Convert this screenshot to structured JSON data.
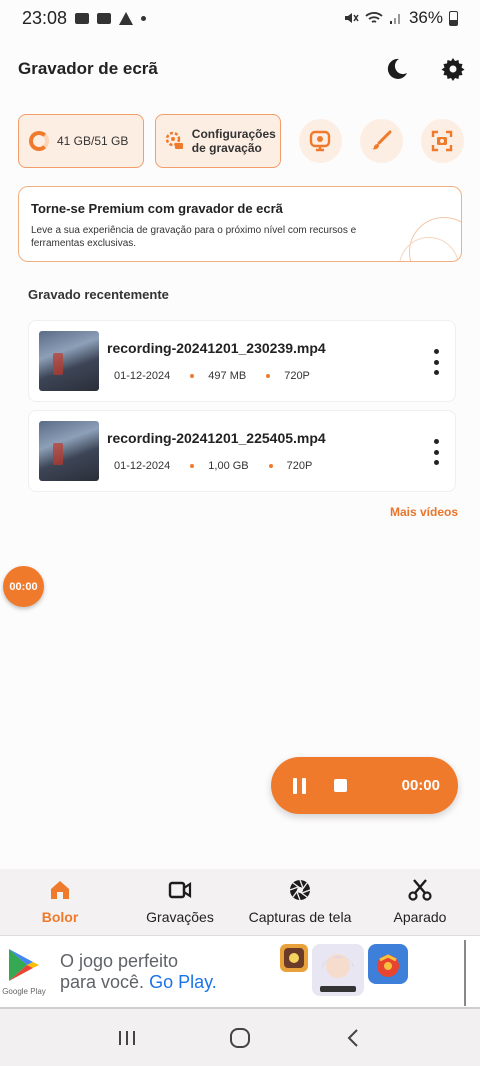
{
  "status_bar": {
    "time": "23:08",
    "battery": "36%"
  },
  "header": {
    "title": "Gravador de ecrã",
    "icons": [
      "moon-icon",
      "gear-icon"
    ]
  },
  "tools": {
    "storage_label": "41 GB/51 GB",
    "config_label_line1": "Configurações",
    "config_label_line2": "de gravação",
    "round_tools": [
      "webcam-icon",
      "brush-icon",
      "screenshot-icon"
    ]
  },
  "premium": {
    "title": "Torne-se Premium com gravador de ecrã",
    "description": "Leve a sua experiência de gravação para o próximo nível com recursos e ferramentas exclusivas."
  },
  "recent": {
    "section_title": "Gravado recentemente",
    "items": [
      {
        "name": "recording-20241201_230239.mp4",
        "date": "01-12-2024",
        "size": "497 MB",
        "resolution": "720P"
      },
      {
        "name": "recording-20241201_225405.mp4",
        "date": "01-12-2024",
        "size": "1,00 GB",
        "resolution": "720P"
      }
    ],
    "more_label": "Mais vídeos"
  },
  "floating_timer": "00:00",
  "record_bar": {
    "time": "00:00"
  },
  "bottom_nav": {
    "items": [
      {
        "label": "Bolor",
        "icon": "home-icon",
        "active": true
      },
      {
        "label": "Gravações",
        "icon": "video-camera-icon",
        "active": false
      },
      {
        "label": "Capturas de tela",
        "icon": "aperture-icon",
        "active": false
      },
      {
        "label": "Aparado",
        "icon": "scissors-icon",
        "active": false
      }
    ]
  },
  "ad": {
    "logo_label": "Google Play",
    "line1": "O jogo perfeito",
    "line2_prefix": "para você. ",
    "line2_accent": "Go Play."
  },
  "colors": {
    "accent": "#f07a2c",
    "accent_light": "#fdeee4",
    "link_blue": "#1a73e8"
  }
}
